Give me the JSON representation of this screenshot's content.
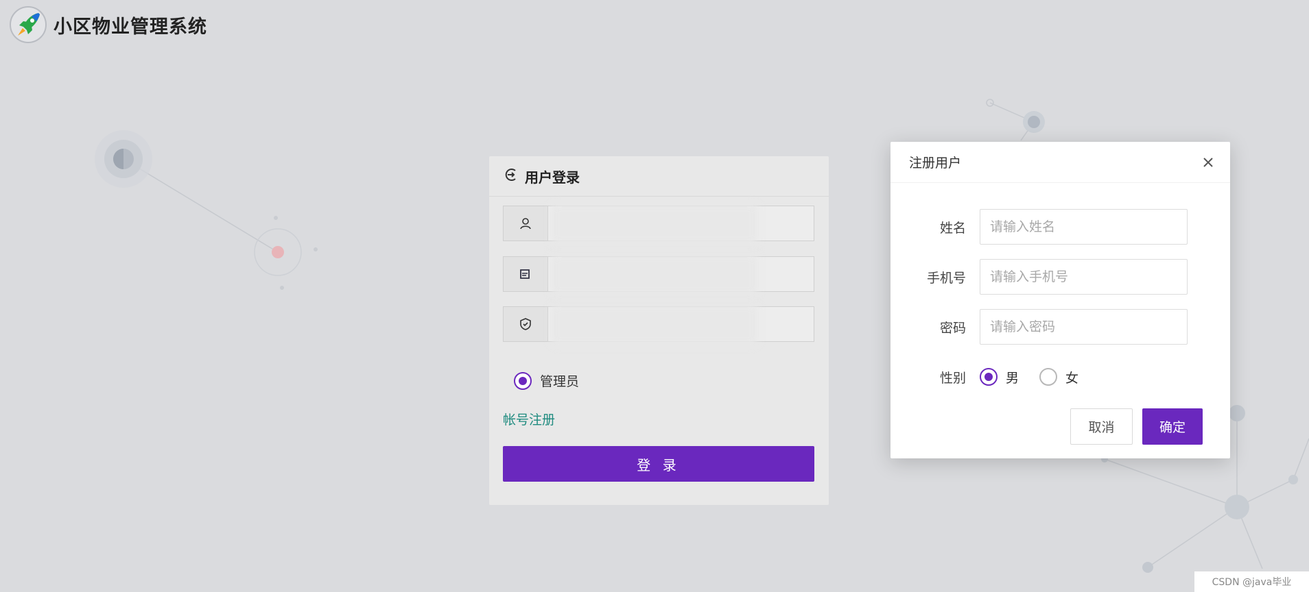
{
  "header": {
    "title": "小区物业管理系统",
    "logo_icon": "rocket-icon"
  },
  "login": {
    "title": "用户登录",
    "title_icon": "login-icon",
    "username_icon": "user-icon",
    "captcha_icon": "captcha-icon",
    "security_icon": "shield-check-icon",
    "role_label": "管理员",
    "role_selected": true,
    "register_link": "帐号注册",
    "login_button": "登 录"
  },
  "dialog": {
    "title": "注册用户",
    "fields": [
      {
        "label": "姓名",
        "placeholder": "请输入姓名"
      },
      {
        "label": "手机号",
        "placeholder": "请输入手机号"
      },
      {
        "label": "密码",
        "placeholder": "请输入密码"
      }
    ],
    "gender_label": "性别",
    "gender_options": [
      "男",
      "女"
    ],
    "gender_selected": "男",
    "cancel_button": "取消",
    "ok_button": "确定"
  },
  "watermark": "CSDN @java毕业",
  "colors": {
    "accent": "#6a28be",
    "link": "#1f8b7f",
    "background": "#dadbde"
  }
}
